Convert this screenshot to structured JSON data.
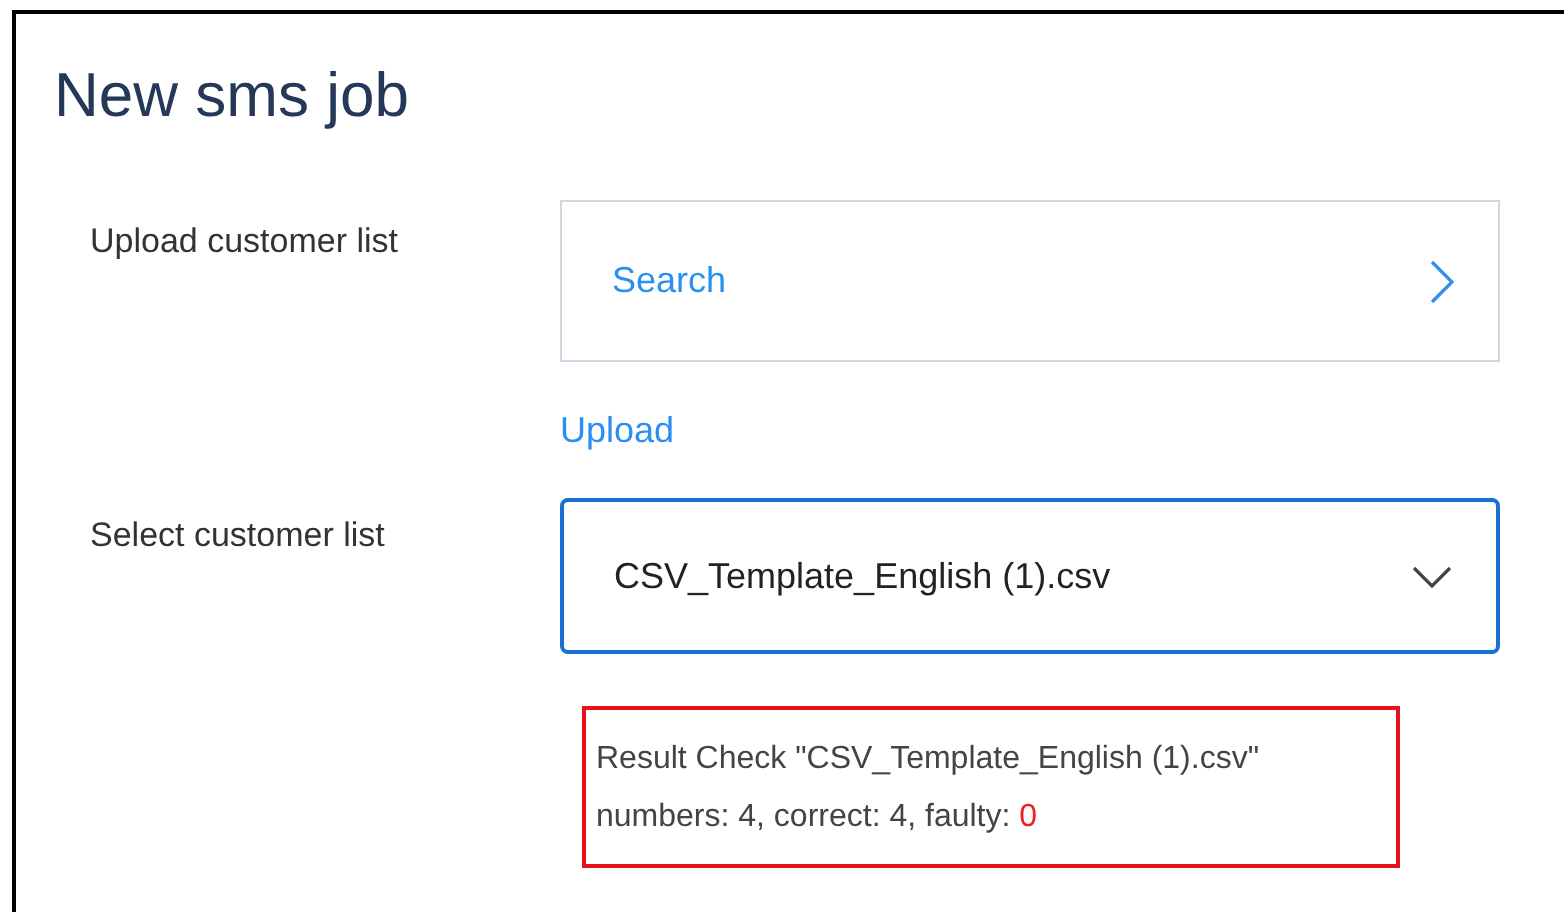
{
  "title": "New sms job",
  "upload": {
    "label": "Upload customer list",
    "search": "Search",
    "upload_link": "Upload"
  },
  "select": {
    "label": "Select customer list",
    "value": "CSV_Template_English (1).csv",
    "focused": true
  },
  "result": {
    "line_1": "Result Check \"CSV_Template_English (1).csv\"",
    "summary": "numbers: 4, correct: 4, faulty:",
    "faulty": "0"
  }
}
